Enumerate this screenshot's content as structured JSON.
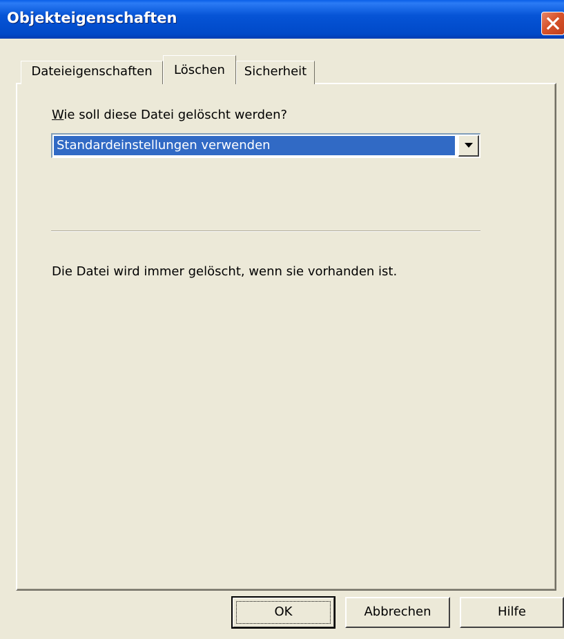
{
  "window": {
    "title": "Objekteigenschaften"
  },
  "tabs": [
    {
      "label": "Dateieigenschaften",
      "selected": false
    },
    {
      "label": "Löschen",
      "selected": true
    },
    {
      "label": "Sicherheit",
      "selected": false
    }
  ],
  "delete_tab": {
    "question_mnemonic": "W",
    "question_rest": "ie soll diese Datei gelöscht werden?",
    "combo_value": "Standardeinstellungen verwenden",
    "info_text": "Die Datei wird immer gelöscht, wenn sie vorhanden ist."
  },
  "buttons": {
    "ok": "OK",
    "cancel": "Abbrechen",
    "help": "Hilfe"
  },
  "icons": {
    "close": "close-icon",
    "dropdown": "chevron-down-icon"
  },
  "colors": {
    "titlebar": "#0054e3",
    "close_button": "#d8542b",
    "selection": "#316ac5",
    "dialog_bg": "#ece9d8"
  }
}
